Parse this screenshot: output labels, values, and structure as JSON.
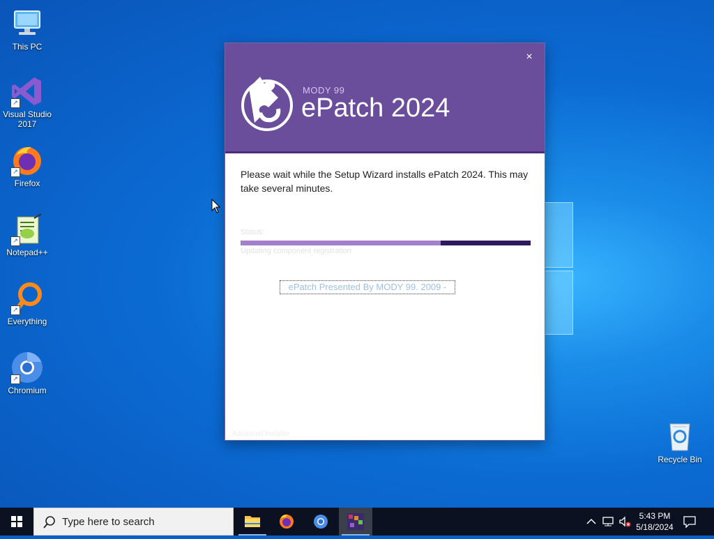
{
  "desktop_icons": [
    {
      "label": "This PC",
      "icon": "this-pc-icon"
    },
    {
      "label": "Visual Studio 2017",
      "icon": "visual-studio-icon"
    },
    {
      "label": "Firefox",
      "icon": "firefox-icon"
    },
    {
      "label": "Notepad++",
      "icon": "notepadpp-icon"
    },
    {
      "label": "Everything",
      "icon": "everything-icon"
    },
    {
      "label": "Chromium",
      "icon": "chromium-icon"
    },
    {
      "label": "Recycle Bin",
      "icon": "recycle-bin-icon"
    }
  ],
  "dialog": {
    "brand_small": "MODY 99",
    "brand_big": "ePatch 2024",
    "close_symbol": "×",
    "message": "Please wait while the Setup Wizard installs ePatch 2024.  This may take several minutes.",
    "status_label": "Status:",
    "status_detail": "Updating component registration",
    "progress": 0.69,
    "presented": "ePatch Presented By MODY 99. 2009 -",
    "footer": "Advanced Installer",
    "colors": {
      "header": "#6a4e9c",
      "progress_fill": "#a37fcc",
      "progress_track": "#2e1a5c"
    }
  },
  "taskbar": {
    "search_placeholder": "Type here to search",
    "apps": [
      {
        "name": "File Explorer",
        "icon": "folder-icon"
      },
      {
        "name": "Firefox",
        "icon": "firefox-icon"
      },
      {
        "name": "Chromium",
        "icon": "chromium-icon"
      },
      {
        "name": "ePatch Setup",
        "icon": "epatch-setup-icon"
      }
    ],
    "time": "5:43 PM",
    "date": "5/18/2024"
  }
}
